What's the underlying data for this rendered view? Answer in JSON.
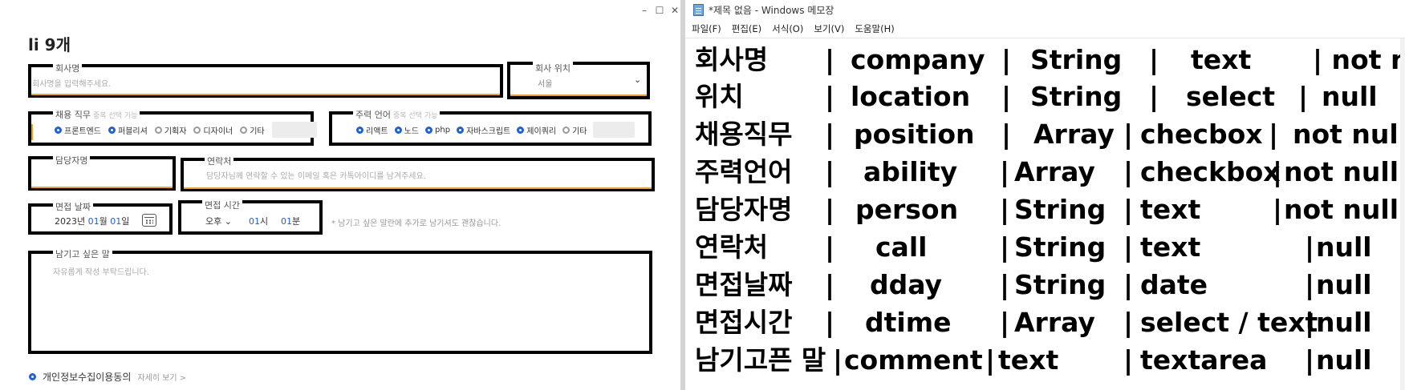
{
  "form_window": {
    "controls": [
      "–",
      "☐",
      "✕"
    ],
    "title": "li 9개",
    "company": {
      "label": "회사명",
      "placeholder": "회사명을 입력해주세요."
    },
    "location": {
      "label": "회사 위치",
      "value": "서울"
    },
    "position": {
      "label": "채용 직무",
      "sublabel": "중복 선택 가능",
      "options": [
        {
          "label": "프론트엔드",
          "checked": true
        },
        {
          "label": "퍼블리셔",
          "checked": true
        },
        {
          "label": "기획자",
          "checked": false
        },
        {
          "label": "디자이너",
          "checked": false
        },
        {
          "label": "기타",
          "checked": false
        }
      ]
    },
    "ability": {
      "label": "주력 언어",
      "sublabel": "중복 선택 가능",
      "options": [
        {
          "label": "리액트",
          "checked": true
        },
        {
          "label": "노드",
          "checked": true
        },
        {
          "label": "php",
          "checked": true
        },
        {
          "label": "자바스크립트",
          "checked": true
        },
        {
          "label": "제이쿼리",
          "checked": true
        },
        {
          "label": "기타",
          "checked": false
        }
      ]
    },
    "person": {
      "label": "담당자명"
    },
    "call": {
      "label": "연락처",
      "placeholder": "담당자님께 연락할 수 있는 이메일 혹은 카톡아이디를 남겨주세요."
    },
    "dday": {
      "label": "면접 날짜",
      "year": "2023년",
      "month": "01",
      "month_unit": "월",
      "day": "01",
      "day_unit": "일"
    },
    "dtime": {
      "label": "면접 시간",
      "ampm": "오후",
      "hour": "01",
      "hour_unit": "시",
      "minute": "01",
      "minute_unit": "분"
    },
    "dtime_hint": "* 남기고 싶은 말란에 추가로 남기셔도 괜찮습니다.",
    "comment": {
      "label": "남기고 싶은 말",
      "placeholder": "자유롭게 작성 부탁드립니다."
    },
    "privacy": {
      "label": "개인정보수집이용동의",
      "more": "자세히 보기 >"
    }
  },
  "notepad": {
    "title": "*제목 없음 - Windows 메모장",
    "menu": [
      "파일(F)",
      "편집(E)",
      "서식(O)",
      "보기(V)",
      "도움말(H)"
    ],
    "rows": [
      [
        "회사명",
        "|",
        "company",
        "|",
        "String",
        "|",
        "text",
        "| not null"
      ],
      [
        "위치",
        "|",
        "location",
        "|",
        "String",
        "|",
        "select",
        "|",
        "null"
      ],
      [
        "채용직무",
        "|",
        "position",
        "|",
        "Array",
        "|",
        "checbox",
        "|",
        "not null"
      ],
      [
        "주력언어",
        "|",
        "ability",
        "|",
        "Array",
        "|",
        "checkbox",
        "|",
        "not null"
      ],
      [
        "담당자명",
        "|",
        "person",
        "|",
        "String",
        "|",
        "text",
        "|",
        "not null"
      ],
      [
        "연락처",
        "|",
        "call",
        "|",
        "String",
        "|",
        "text",
        "|",
        "null"
      ],
      [
        "면접날짜",
        "|",
        "dday",
        "|",
        "String",
        "|",
        "date",
        "|",
        "null"
      ],
      [
        "면접시간",
        "|",
        "dtime",
        "|",
        "Array",
        "|",
        "select / text",
        "|",
        "null"
      ],
      [
        "남기고픈 말",
        "|",
        "comment",
        "|",
        "text",
        "|",
        "textarea",
        "|",
        "null"
      ]
    ]
  }
}
